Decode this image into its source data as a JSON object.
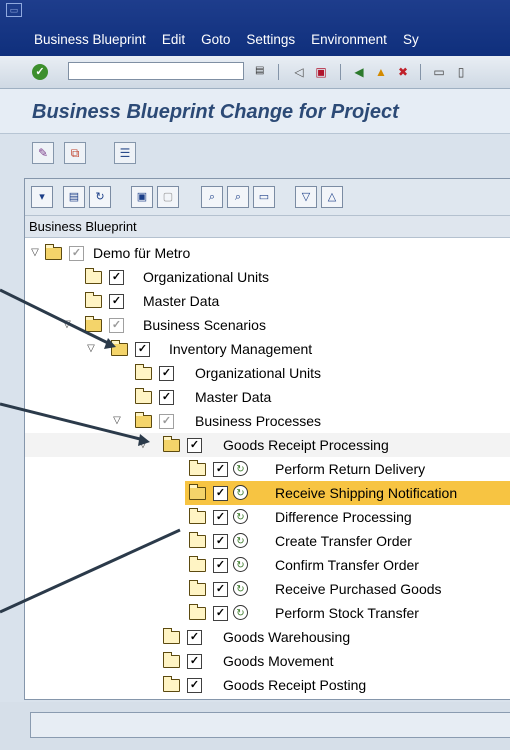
{
  "menu": {
    "items": [
      "Business Blueprint",
      "Edit",
      "Goto",
      "Settings",
      "Environment",
      "Sy"
    ]
  },
  "std_toolbar": {
    "command_value": "",
    "icons": [
      "enter-icon",
      "save-icon",
      "back-icon",
      "exit-icon",
      "cancel-icon",
      "print-icon"
    ]
  },
  "title": "Business Blueprint Change for Project",
  "tree": {
    "column_header": "Business Blueprint",
    "rows": [
      {
        "label": "Demo für Metro"
      },
      {
        "label": "Organizational Units"
      },
      {
        "label": "Master Data"
      },
      {
        "label": "Business Scenarios"
      },
      {
        "label": "Inventory Management"
      },
      {
        "label": "Organizational Units"
      },
      {
        "label": "Master Data"
      },
      {
        "label": "Business Processes"
      },
      {
        "label": "Goods Receipt Processing"
      },
      {
        "label": "Perform Return Delivery"
      },
      {
        "label": "Receive Shipping Notification"
      },
      {
        "label": "Difference Processing"
      },
      {
        "label": "Create Transfer Order"
      },
      {
        "label": "Confirm Transfer Order"
      },
      {
        "label": "Receive Purchased Goods"
      },
      {
        "label": "Perform Stock Transfer"
      },
      {
        "label": "Goods Warehousing"
      },
      {
        "label": "Goods Movement"
      },
      {
        "label": "Goods Receipt Posting"
      }
    ],
    "selected_row": "Receive Shipping Notification"
  },
  "colors": {
    "menubar": "#0f2f7c",
    "title_text": "#2c4a76",
    "selection": "#f7c442",
    "callout": "#2b3a4a"
  }
}
